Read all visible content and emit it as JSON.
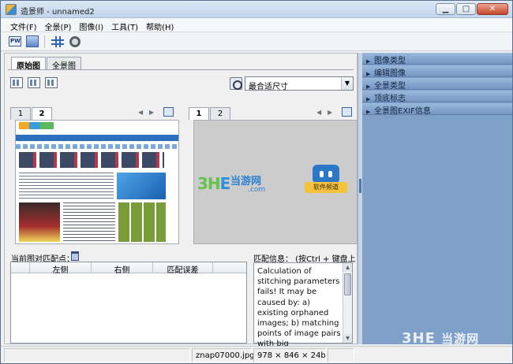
{
  "window": {
    "title": "造景师 - unnamed2",
    "controls": [
      "minimize",
      "maximize",
      "close"
    ]
  },
  "menu": [
    "文件(F)",
    "全景(P)",
    "图像(I)",
    "工具(T)",
    "帮助(H)"
  ],
  "toolbar": {
    "pw_label": "PW",
    "icons": [
      "panorama-window-icon",
      "image-window-icon",
      "grid-tool-icon",
      "settings-gear-icon"
    ]
  },
  "left_panel": {
    "tabs": [
      {
        "label": "原始图",
        "active": true
      },
      {
        "label": "全景图",
        "active": false
      }
    ],
    "fit_select": {
      "selected": "最合适尺寸"
    },
    "pane_left": {
      "tabs": [
        "1",
        "2"
      ],
      "active_tab": "2"
    },
    "pane_right": {
      "tabs": [
        "1",
        "2"
      ],
      "active_tab": "1"
    },
    "right_image_text": {
      "logo_3": "3H",
      "logo_e": "E",
      "site": "当游网",
      "domain": ".com",
      "banner": "软件频道"
    },
    "match_points": {
      "label": "当前图对匹配点：",
      "columns": [
        "",
        "左侧",
        "右侧",
        "匹配误差"
      ]
    },
    "match_info": {
      "label": "匹配信息： (按Ctrl + 键盘上",
      "text": "Calculation of stitching parameters fails! It may be caused by: a) existing orphaned images; b) matching points of image pairs with big"
    }
  },
  "task_panel": {
    "items": [
      "图像类型",
      "编辑图像",
      "全景类型",
      "顶底标志",
      "全景图EXIF信息"
    ]
  },
  "statusbar": {
    "filename": "znap07000.jpg",
    "dimensions": "978 × 846 × 24b"
  },
  "watermark": {
    "brand": "3HE",
    "site": "当游网"
  }
}
